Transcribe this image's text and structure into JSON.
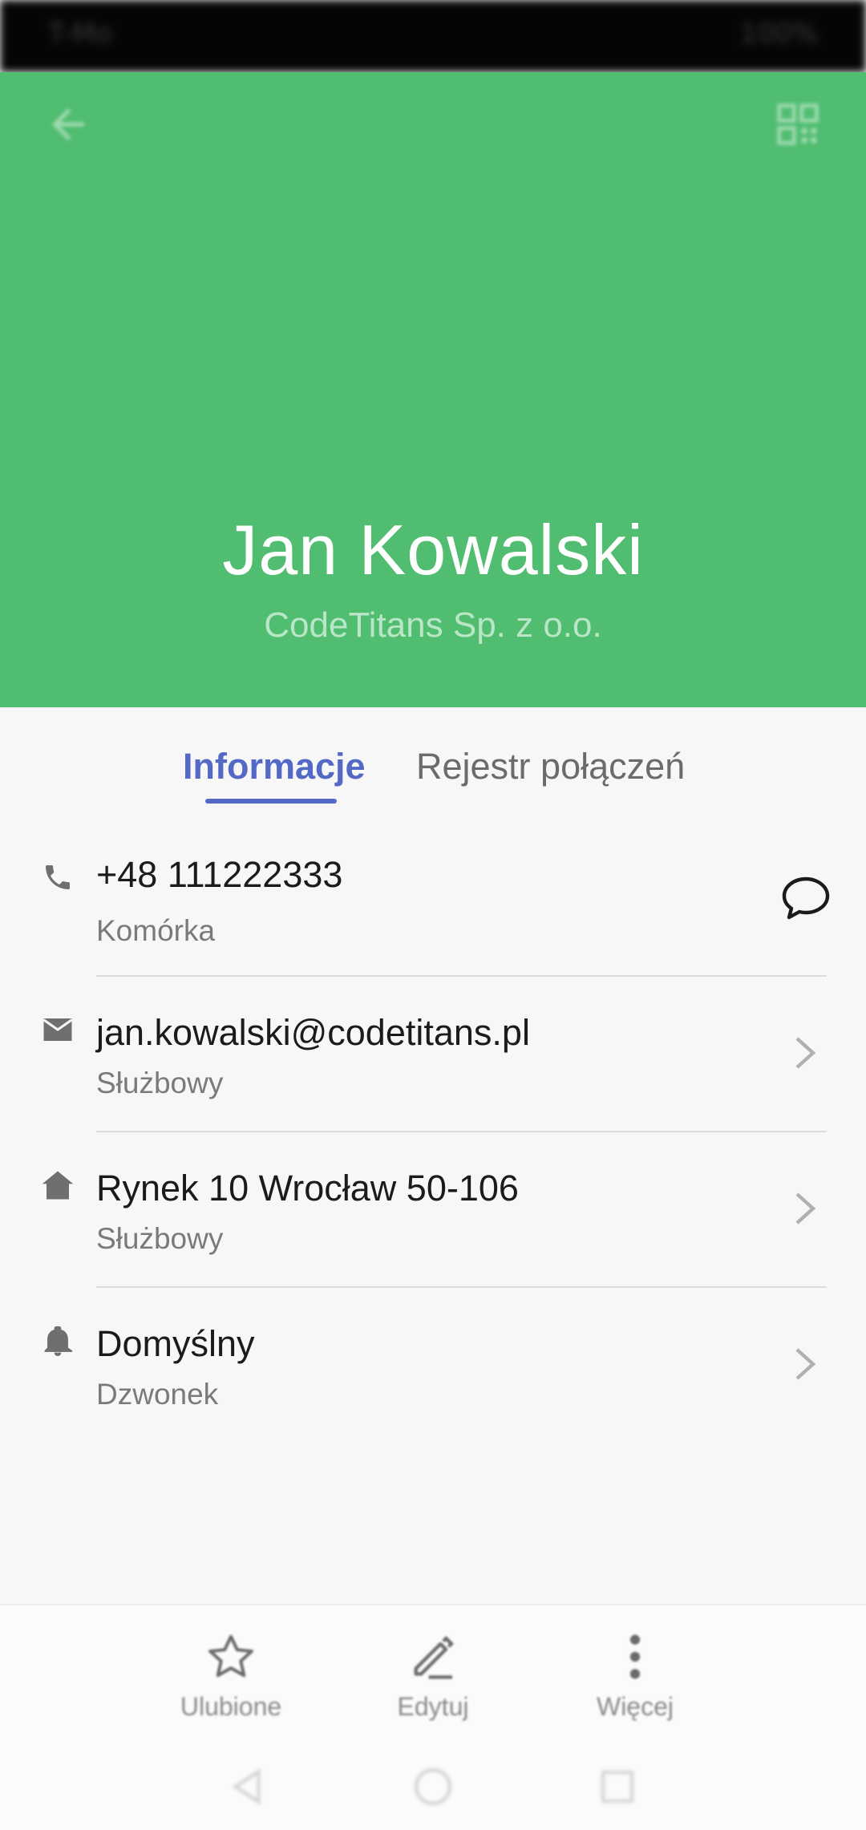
{
  "status_bar": {
    "left_text": "T-Mo",
    "right_text": "100%"
  },
  "header": {
    "name": "Jan Kowalski",
    "company": "CodeTitans Sp. z o.o.",
    "background": "#51bd71"
  },
  "tabs": [
    {
      "label": "Informacje",
      "active": true
    },
    {
      "label": "Rejestr połączeń",
      "active": false
    }
  ],
  "details": {
    "phone": {
      "value": "+48 111222333",
      "type": "Komórka",
      "icon": "phone-icon",
      "action_icon": "message-icon"
    },
    "email": {
      "value": "jan.kowalski@codetitans.pl",
      "type": "Służbowy",
      "icon": "mail-icon"
    },
    "address": {
      "value": "Rynek 10 Wrocław 50-106",
      "type": "Służbowy",
      "icon": "home-icon"
    },
    "ringtone": {
      "value": "Domyślny",
      "type": "Dzwonek",
      "icon": "bell-icon"
    }
  },
  "bottom_bar": {
    "favorite": "Ulubione",
    "edit": "Edytuj",
    "more": "Więcej"
  },
  "colors": {
    "accent": "#5468c6",
    "header_green": "#51bd71"
  }
}
